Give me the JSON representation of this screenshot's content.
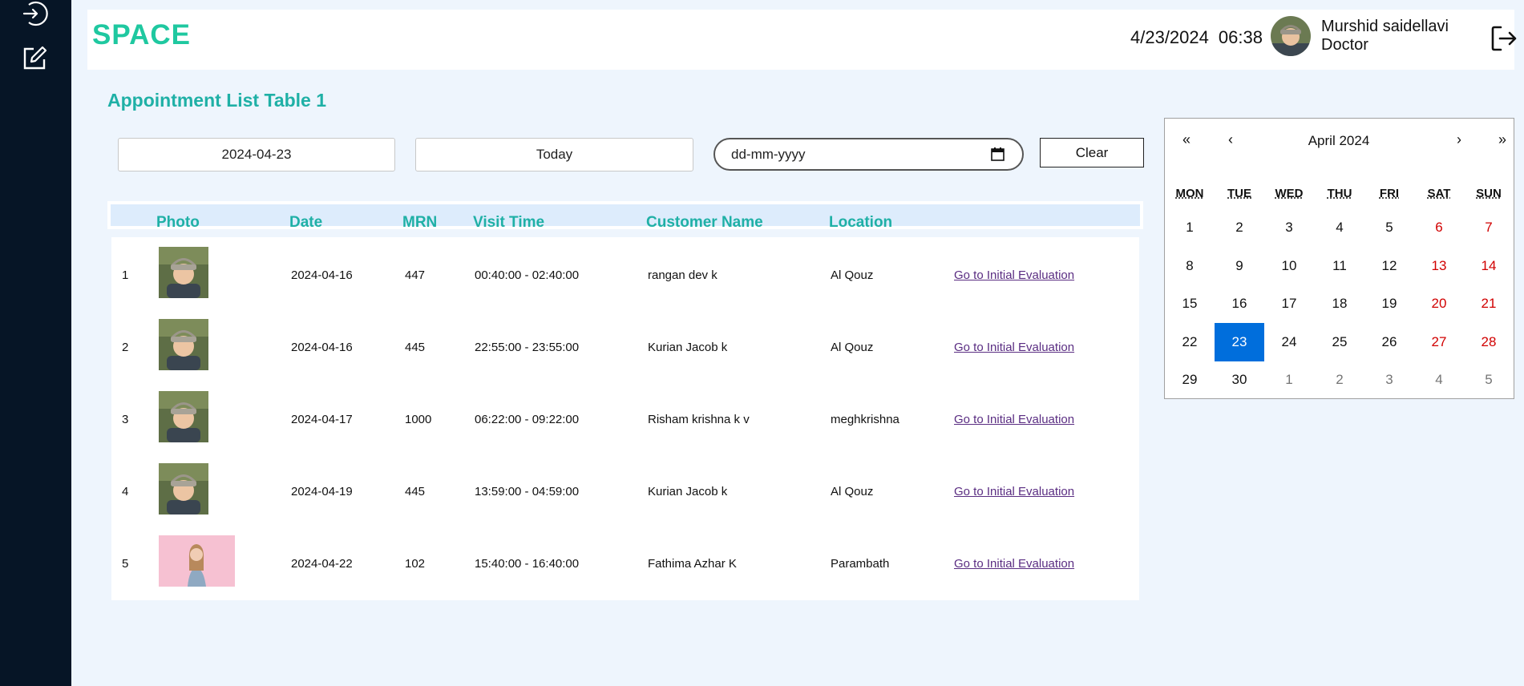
{
  "colors": {
    "sidebar": "#061526",
    "accent": "#1fb0a6",
    "selected_day": "#006edc",
    "weekend": "#d10000",
    "link": "#5a2d82"
  },
  "sidebar": {
    "icons": [
      "login-icon",
      "edit-icon"
    ]
  },
  "header": {
    "logo": "SPACE",
    "date": "4/23/2024",
    "time": "06:38",
    "user_name": "Murshid saidellavi",
    "user_role": "Doctor"
  },
  "page_title": "Appointment List Table 1",
  "filters": {
    "date_value": "2024-04-23",
    "today_label": "Today",
    "date_placeholder": "dd-mm-yyyy",
    "clear_label": "Clear"
  },
  "table": {
    "headers": [
      "Photo",
      "Date",
      "MRN",
      "Visit Time",
      "Customer Name",
      "Location"
    ],
    "rows": [
      {
        "no": "1",
        "date": "2024-04-16",
        "mrn": "447",
        "visit_time": "00:40:00 - 02:40:00",
        "name": "rangan dev k",
        "location": "Al Qouz",
        "action": "Go to Initial Evaluation",
        "photo": "boy"
      },
      {
        "no": "2",
        "date": "2024-04-16",
        "mrn": "445",
        "visit_time": "22:55:00 - 23:55:00",
        "name": "Kurian Jacob k",
        "location": "Al Qouz",
        "action": "Go to Initial Evaluation",
        "photo": "boy"
      },
      {
        "no": "3",
        "date": "2024-04-17",
        "mrn": "1000",
        "visit_time": "06:22:00 - 09:22:00",
        "name": "Risham krishna k v",
        "location": "meghkrishna",
        "action": "Go to Initial Evaluation",
        "photo": "boy"
      },
      {
        "no": "4",
        "date": "2024-04-19",
        "mrn": "445",
        "visit_time": "13:59:00 - 04:59:00",
        "name": "Kurian Jacob k",
        "location": "Al Qouz",
        "action": "Go to Initial Evaluation",
        "photo": "boy"
      },
      {
        "no": "5",
        "date": "2024-04-22",
        "mrn": "102",
        "visit_time": "15:40:00 - 16:40:00",
        "name": "Fathima Azhar K",
        "location": "Parambath",
        "action": "Go to Initial Evaluation",
        "photo": "girl"
      }
    ]
  },
  "calendar": {
    "nav": {
      "prev_year": "«",
      "prev_month": "‹",
      "next_month": "›",
      "next_year": "»"
    },
    "month_label": "April 2024",
    "weekdays": [
      "MON",
      "TUE",
      "WED",
      "THU",
      "FRI",
      "SAT",
      "SUN"
    ],
    "weeks": [
      [
        "1",
        "2",
        "3",
        "4",
        "5",
        "6",
        "7"
      ],
      [
        "8",
        "9",
        "10",
        "11",
        "12",
        "13",
        "14"
      ],
      [
        "15",
        "16",
        "17",
        "18",
        "19",
        "20",
        "21"
      ],
      [
        "22",
        "23",
        "24",
        "25",
        "26",
        "27",
        "28"
      ],
      [
        "29",
        "30",
        "1",
        "2",
        "3",
        "4",
        "5"
      ]
    ],
    "selected": "23"
  }
}
